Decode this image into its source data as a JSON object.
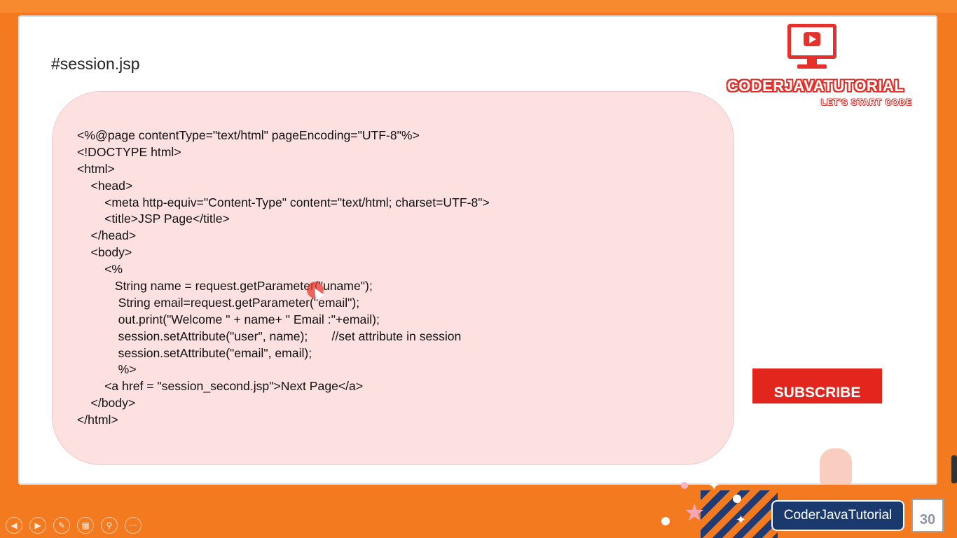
{
  "slide": {
    "title": "#session.jsp",
    "code_lines": [
      "<%@page contentType=\"text/html\" pageEncoding=\"UTF-8\"%>",
      "<!DOCTYPE html>",
      "<html>",
      "    <head>",
      "        <meta http-equiv=\"Content-Type\" content=\"text/html; charset=UTF-8\">",
      "        <title>JSP Page</title>",
      "    </head>",
      "    <body>",
      "        <%",
      "           String name = request.getParameter(\"uname\");",
      "            String email=request.getParameter(\"email\");",
      "            out.print(\"Welcome \" + name+ \" Email :\"+email);",
      "            session.setAttribute(\"user\", name);       //set attribute in session",
      "            session.setAttribute(\"email\", email);",
      "            %>",
      "        <a href = \"session_second.jsp\">Next Page</a>",
      "    </body>",
      "</html>"
    ]
  },
  "logo": {
    "brand_name": "CODERJAVATUTORIAL",
    "tagline": "LET'S START CODE",
    "icon": "monitor-play-icon"
  },
  "subscribe_label": "SUBSCRIBE",
  "footer": {
    "channel_name": "CoderJavaTutorial",
    "page_number": "30"
  },
  "colors": {
    "accent_orange": "#f47a1f",
    "brand_red": "#e4312b",
    "code_bg": "#fde0e0",
    "badge_blue": "#1a3a6e"
  }
}
